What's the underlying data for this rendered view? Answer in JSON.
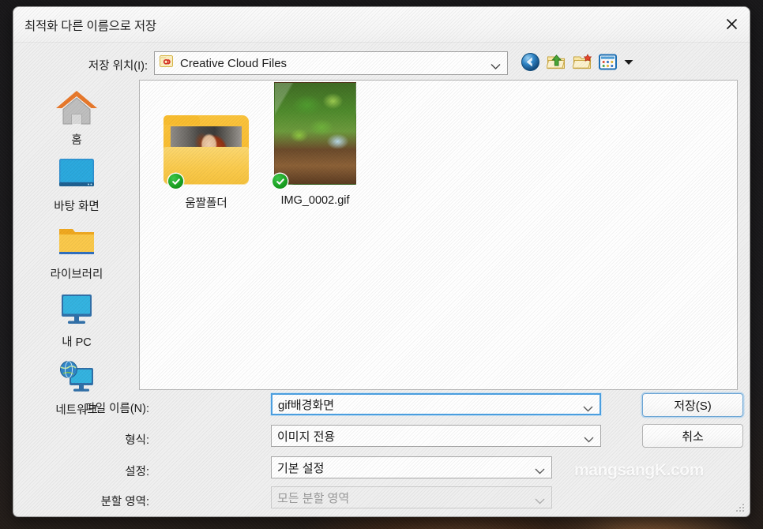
{
  "window": {
    "title": "최적화 다른 이름으로 저장",
    "close_icon": "close-icon"
  },
  "location_bar": {
    "label": "저장 위치(I):",
    "value": "Creative Cloud Files",
    "icon": "creative-cloud-folder-icon",
    "chevron_icon": "chevron-down-icon"
  },
  "toolbar": {
    "back": "back-icon",
    "up": "up-one-level-icon",
    "new_folder": "new-folder-icon",
    "views": "view-mode-icon",
    "views_caret": "chevron-down-icon"
  },
  "sidebar": {
    "items": [
      {
        "label": "홈",
        "icon": "home-icon"
      },
      {
        "label": "바탕 화면",
        "icon": "desktop-icon"
      },
      {
        "label": "라이브러리",
        "icon": "library-folder-icon"
      },
      {
        "label": "내 PC",
        "icon": "this-pc-icon"
      },
      {
        "label": "네트워크",
        "icon": "network-icon"
      }
    ]
  },
  "file_list": {
    "items": [
      {
        "name": "움짤폴더",
        "type": "folder",
        "badge": "synced-check-icon"
      },
      {
        "name": "IMG_0002.gif",
        "type": "image",
        "badge": "synced-check-icon"
      }
    ]
  },
  "form": {
    "fields": [
      {
        "label": "파일 이름(N):",
        "value": "gif배경화면",
        "state": "focused"
      },
      {
        "label": "형식:",
        "value": "이미지 전용",
        "state": "normal"
      },
      {
        "label": "설정:",
        "value": "기본 설정",
        "state": "normal"
      },
      {
        "label": "분할 영역:",
        "value": "모든 분할 영역",
        "state": "disabled"
      }
    ]
  },
  "buttons": {
    "save": "저장(S)",
    "cancel": "취소"
  },
  "watermark": "mangsangK.com",
  "colors": {
    "dialog_bg": "#f0f0f0",
    "focus_blue": "#4ba0e2",
    "folder_yellow": "#f7b827",
    "sync_green": "#17a11f"
  }
}
